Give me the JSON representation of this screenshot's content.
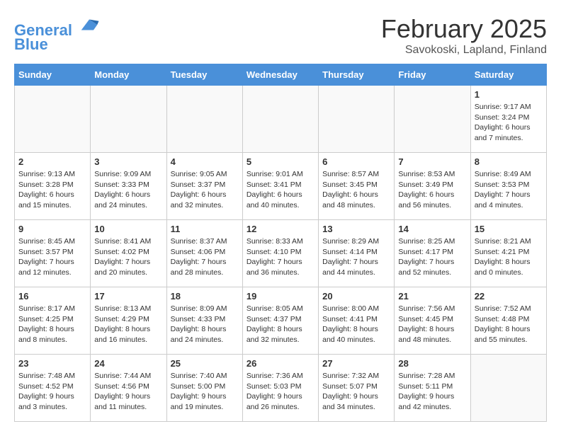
{
  "header": {
    "logo_line1": "General",
    "logo_line2": "Blue",
    "month_title": "February 2025",
    "location": "Savokoski, Lapland, Finland"
  },
  "weekdays": [
    "Sunday",
    "Monday",
    "Tuesday",
    "Wednesday",
    "Thursday",
    "Friday",
    "Saturday"
  ],
  "weeks": [
    [
      {
        "day": "",
        "info": ""
      },
      {
        "day": "",
        "info": ""
      },
      {
        "day": "",
        "info": ""
      },
      {
        "day": "",
        "info": ""
      },
      {
        "day": "",
        "info": ""
      },
      {
        "day": "",
        "info": ""
      },
      {
        "day": "1",
        "info": "Sunrise: 9:17 AM\nSunset: 3:24 PM\nDaylight: 6 hours\nand 7 minutes."
      }
    ],
    [
      {
        "day": "2",
        "info": "Sunrise: 9:13 AM\nSunset: 3:28 PM\nDaylight: 6 hours\nand 15 minutes."
      },
      {
        "day": "3",
        "info": "Sunrise: 9:09 AM\nSunset: 3:33 PM\nDaylight: 6 hours\nand 24 minutes."
      },
      {
        "day": "4",
        "info": "Sunrise: 9:05 AM\nSunset: 3:37 PM\nDaylight: 6 hours\nand 32 minutes."
      },
      {
        "day": "5",
        "info": "Sunrise: 9:01 AM\nSunset: 3:41 PM\nDaylight: 6 hours\nand 40 minutes."
      },
      {
        "day": "6",
        "info": "Sunrise: 8:57 AM\nSunset: 3:45 PM\nDaylight: 6 hours\nand 48 minutes."
      },
      {
        "day": "7",
        "info": "Sunrise: 8:53 AM\nSunset: 3:49 PM\nDaylight: 6 hours\nand 56 minutes."
      },
      {
        "day": "8",
        "info": "Sunrise: 8:49 AM\nSunset: 3:53 PM\nDaylight: 7 hours\nand 4 minutes."
      }
    ],
    [
      {
        "day": "9",
        "info": "Sunrise: 8:45 AM\nSunset: 3:57 PM\nDaylight: 7 hours\nand 12 minutes."
      },
      {
        "day": "10",
        "info": "Sunrise: 8:41 AM\nSunset: 4:02 PM\nDaylight: 7 hours\nand 20 minutes."
      },
      {
        "day": "11",
        "info": "Sunrise: 8:37 AM\nSunset: 4:06 PM\nDaylight: 7 hours\nand 28 minutes."
      },
      {
        "day": "12",
        "info": "Sunrise: 8:33 AM\nSunset: 4:10 PM\nDaylight: 7 hours\nand 36 minutes."
      },
      {
        "day": "13",
        "info": "Sunrise: 8:29 AM\nSunset: 4:14 PM\nDaylight: 7 hours\nand 44 minutes."
      },
      {
        "day": "14",
        "info": "Sunrise: 8:25 AM\nSunset: 4:17 PM\nDaylight: 7 hours\nand 52 minutes."
      },
      {
        "day": "15",
        "info": "Sunrise: 8:21 AM\nSunset: 4:21 PM\nDaylight: 8 hours\nand 0 minutes."
      }
    ],
    [
      {
        "day": "16",
        "info": "Sunrise: 8:17 AM\nSunset: 4:25 PM\nDaylight: 8 hours\nand 8 minutes."
      },
      {
        "day": "17",
        "info": "Sunrise: 8:13 AM\nSunset: 4:29 PM\nDaylight: 8 hours\nand 16 minutes."
      },
      {
        "day": "18",
        "info": "Sunrise: 8:09 AM\nSunset: 4:33 PM\nDaylight: 8 hours\nand 24 minutes."
      },
      {
        "day": "19",
        "info": "Sunrise: 8:05 AM\nSunset: 4:37 PM\nDaylight: 8 hours\nand 32 minutes."
      },
      {
        "day": "20",
        "info": "Sunrise: 8:00 AM\nSunset: 4:41 PM\nDaylight: 8 hours\nand 40 minutes."
      },
      {
        "day": "21",
        "info": "Sunrise: 7:56 AM\nSunset: 4:45 PM\nDaylight: 8 hours\nand 48 minutes."
      },
      {
        "day": "22",
        "info": "Sunrise: 7:52 AM\nSunset: 4:48 PM\nDaylight: 8 hours\nand 55 minutes."
      }
    ],
    [
      {
        "day": "23",
        "info": "Sunrise: 7:48 AM\nSunset: 4:52 PM\nDaylight: 9 hours\nand 3 minutes."
      },
      {
        "day": "24",
        "info": "Sunrise: 7:44 AM\nSunset: 4:56 PM\nDaylight: 9 hours\nand 11 minutes."
      },
      {
        "day": "25",
        "info": "Sunrise: 7:40 AM\nSunset: 5:00 PM\nDaylight: 9 hours\nand 19 minutes."
      },
      {
        "day": "26",
        "info": "Sunrise: 7:36 AM\nSunset: 5:03 PM\nDaylight: 9 hours\nand 26 minutes."
      },
      {
        "day": "27",
        "info": "Sunrise: 7:32 AM\nSunset: 5:07 PM\nDaylight: 9 hours\nand 34 minutes."
      },
      {
        "day": "28",
        "info": "Sunrise: 7:28 AM\nSunset: 5:11 PM\nDaylight: 9 hours\nand 42 minutes."
      },
      {
        "day": "",
        "info": ""
      }
    ]
  ]
}
